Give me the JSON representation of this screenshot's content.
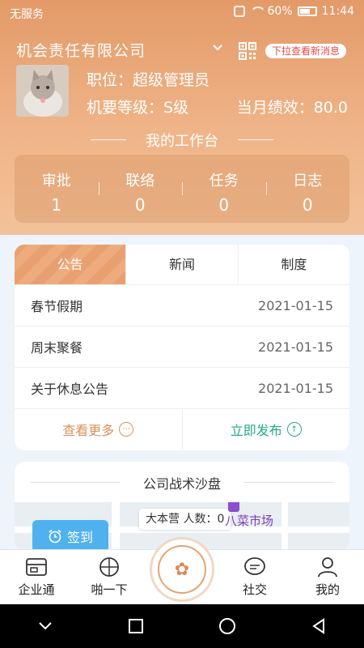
{
  "status_bar": {
    "carrier": "无服务",
    "battery": "60%",
    "time": "11:44"
  },
  "header": {
    "company": "机会责任有限公司",
    "notice_pill": "下拉查看新消息",
    "role": "职位：超级管理员",
    "level": "机要等级：S级",
    "performance": "当月绩效：80.0",
    "workbench_title": "我的工作台"
  },
  "stats": [
    {
      "label": "审批",
      "value": "1"
    },
    {
      "label": "联络",
      "value": "0"
    },
    {
      "label": "任务",
      "value": "0"
    },
    {
      "label": "日志",
      "value": "0"
    }
  ],
  "announcements": {
    "tabs": [
      "公告",
      "新闻",
      "制度"
    ],
    "active_tab": 0,
    "items": [
      {
        "title": "春节假期",
        "date": "2021-01-15"
      },
      {
        "title": "周末聚餐",
        "date": "2021-01-15"
      },
      {
        "title": "关于休息公告",
        "date": "2021-01-15"
      }
    ],
    "more_label": "查看更多",
    "publish_label": "立即发布"
  },
  "sand_table": {
    "title": "公司战术沙盘",
    "checkin_label": "签到",
    "camp_label": "大本营 人数：0",
    "market_label": "八菜市场"
  },
  "bottom_nav": {
    "items": [
      "企业通",
      "啪一下",
      "社交",
      "我的"
    ]
  },
  "colors": {
    "header_orange": "#e39a68",
    "publish_green": "#27a98b",
    "more_orange": "#d8925a",
    "notice_red": "#e44b4b",
    "checkin_blue": "#4fb2ee"
  }
}
